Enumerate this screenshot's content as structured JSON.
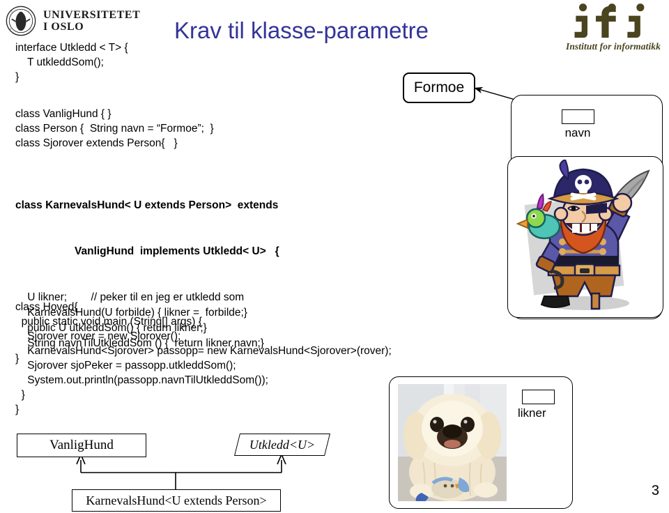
{
  "branding": {
    "university_line1": "UNIVERSITETET",
    "university_line2": "I OSLO",
    "institute_text": "Institutt for informatikk",
    "institute_mark": "ifi",
    "institute_color": "#4a441f"
  },
  "title": "Krav til klasse-parametre",
  "title_color": "#333399",
  "code_blocks": {
    "interface": "interface Utkledd < T> {\n    T utkleddSom();\n}",
    "classes": "class VanligHund { }\nclass Person {  String navn = “Formoe”;  }\nclass Sjorover extends Person{   }",
    "karnevalshund_header_line1": "class KarnevalsHund< U extends Person>  extends",
    "karnevalshund_header_line2": "VanligHund  implements Utkledd< U>   {",
    "karnevalshund_body": "    U likner;        // peker til en jeg er utkledd som\n    KarnevalsHund(U forbilde) { likner =  forbilde;}\n    public U utkleddSom() { return likner;}\n    String navnTilUtkleddSom () {  return likner.navn;}\n}",
    "hoved": "class Hoved{\n  public static void main (String[] args) {\n    Sjorover rover = new Sjorover();\n    KarnevalsHund<Sjorover> passopp= new KarnevalsHund<Sjorover>(rover);\n    Sjorover sjoPeker = passopp.utkleddSom();\n    System.out.println(passopp.navnTilUtkleddSom());\n  }\n}"
  },
  "objects": {
    "formoe_value": "Formoe",
    "navn_field_label": "navn",
    "likner_field_label": "likner"
  },
  "uml": {
    "vanlighund": "VanligHund",
    "utkledd": "Utkledd<U>",
    "karnevalshund": "KarnevalsHund<U extends Person>"
  },
  "page_number": "3"
}
